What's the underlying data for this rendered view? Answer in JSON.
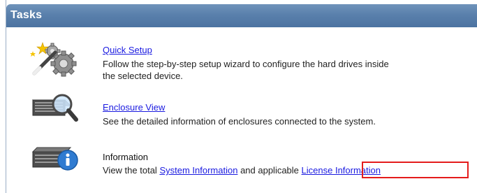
{
  "panel": {
    "title": "Tasks"
  },
  "tasks": [
    {
      "icon": "wand-gears-icon",
      "link": "Quick Setup",
      "desc_line1": "Follow the step-by-step setup wizard to configure the hard drives inside",
      "desc_line2": "the selected device."
    },
    {
      "icon": "enclosure-magnifier-icon",
      "link": "Enclosure View",
      "desc_line1": "See the detailed information of enclosures connected to the system."
    },
    {
      "icon": "enclosure-info-icon",
      "title": "Information",
      "desc_prefix": "View the total",
      "system_info_link": "System Information",
      "desc_middle": "and applicable",
      "license_info_link": "License Information"
    }
  ],
  "colors": {
    "header": "#5a80ac",
    "link": "#1a1ae0",
    "highlight": "#e41c1c"
  }
}
